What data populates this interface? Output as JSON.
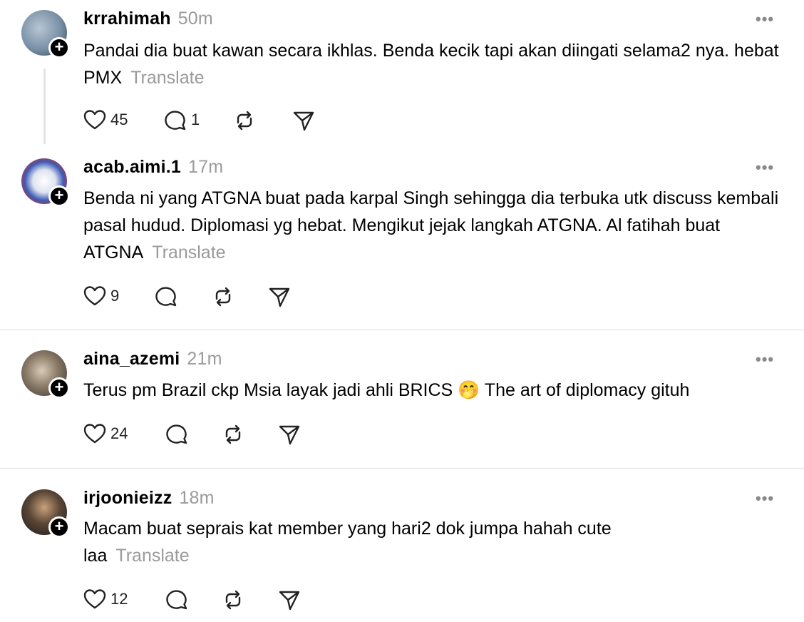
{
  "posts": [
    {
      "username": "krrahimah",
      "time": "50m",
      "text": "Pandai dia buat kawan secara ikhlas. Benda kecik tapi akan diingati selama2 nya. hebat PMX",
      "translate": "Translate",
      "likes": "45",
      "replies": "1",
      "reposts": "",
      "avatar_color": "#6f8aa0"
    },
    {
      "username": "acab.aimi.1",
      "time": "17m",
      "text": "Benda ni yang ATGNA buat pada karpal Singh sehingga dia terbuka utk discuss kembali pasal hudud. Diplomasi yg hebat. Mengikut jejak langkah ATGNA. Al fatihah buat ATGNA",
      "translate": "Translate",
      "likes": "9",
      "replies": "",
      "reposts": "",
      "avatar_color": "#3b5bb5"
    },
    {
      "username": "aina_azemi",
      "time": "21m",
      "text": "Terus pm Brazil ckp Msia layak jadi ahli BRICS 🤭 The art of diplomacy gituh",
      "translate": "",
      "likes": "24",
      "replies": "",
      "reposts": "",
      "avatar_color": "#6b5e52"
    },
    {
      "username": "irjoonieizz",
      "time": "18m",
      "text": "Macam buat seprais kat member yang hari2 dok jumpa hahah cute laa",
      "translate": "Translate",
      "likes": "12",
      "replies": "",
      "reposts": "",
      "avatar_color": "#4a4a4a"
    }
  ],
  "icons": {
    "like": "heart-icon",
    "reply": "comment-icon",
    "repost": "repost-icon",
    "share": "send-icon",
    "more": "more-options-icon",
    "follow": "plus-icon"
  },
  "more_glyph": "•••",
  "follow_glyph": "+"
}
